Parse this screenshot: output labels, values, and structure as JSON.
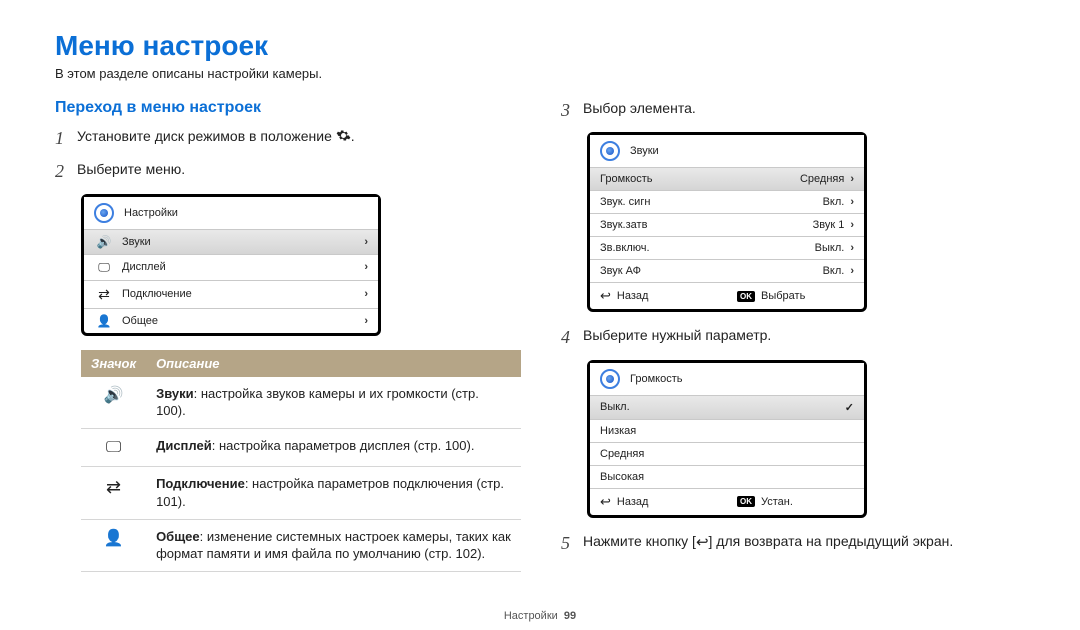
{
  "title": "Меню настроек",
  "intro": "В этом разделе описаны настройки камеры.",
  "subhead": "Переход в меню настроек",
  "steps": {
    "1": "Установите диск режимов в положение",
    "1_suffix": ".",
    "2": "Выберите меню.",
    "3": "Выбор элемента.",
    "4": "Выберите нужный параметр.",
    "5": "Нажмите кнопку [",
    "5_suffix": "] для возврата на предыдущий экран."
  },
  "panelA": {
    "title": "Настройки",
    "items": [
      "Звуки",
      "Дисплей",
      "Подключение",
      "Общее"
    ]
  },
  "panelB": {
    "title": "Звуки",
    "rows": [
      {
        "label": "Громкость",
        "value": "Средняя",
        "hl": true
      },
      {
        "label": "Звук. сигн",
        "value": "Вкл."
      },
      {
        "label": "Звук.затв",
        "value": "Звук 1"
      },
      {
        "label": "Зв.включ.",
        "value": "Выкл."
      },
      {
        "label": "Звук АФ",
        "value": "Вкл."
      }
    ],
    "back": "Назад",
    "select": "Выбрать",
    "ok": "OK"
  },
  "panelC": {
    "title": "Громкость",
    "options": [
      "Выкл.",
      "Низкая",
      "Средняя",
      "Высокая"
    ],
    "checked": 0,
    "back": "Назад",
    "set": "Устан.",
    "ok": "OK"
  },
  "table": {
    "head_icon": "Значок",
    "head_desc": "Описание",
    "rows": [
      {
        "name": "Звуки",
        "desc": ": настройка звуков камеры и их громкости (стр. 100)."
      },
      {
        "name": "Дисплей",
        "desc": ": настройка параметров дисплея (стр. 100)."
      },
      {
        "name": "Подключение",
        "desc": ": настройка параметров подключения (стр. 101)."
      },
      {
        "name": "Общее",
        "desc": ": изменение системных настроек камеры, таких как формат памяти и имя файла по умолчанию (стр. 102)."
      }
    ]
  },
  "footer": {
    "section": "Настройки",
    "page": "99"
  }
}
